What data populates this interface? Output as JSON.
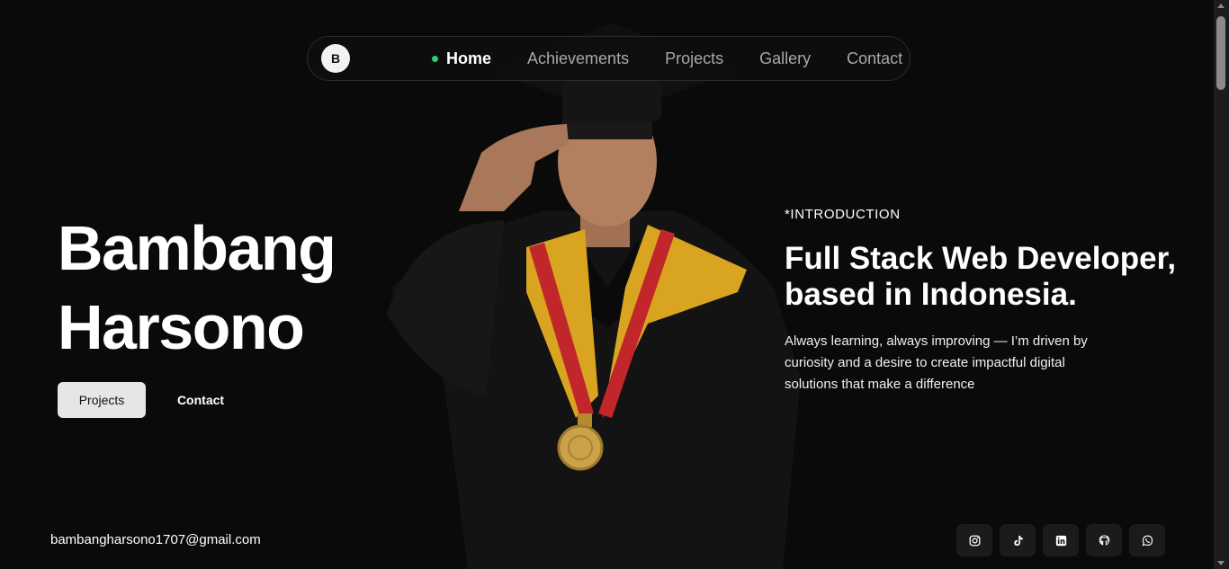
{
  "nav": {
    "logo": "B",
    "items": [
      {
        "label": "Home",
        "active": true
      },
      {
        "label": "Achievements",
        "active": false
      },
      {
        "label": "Projects",
        "active": false
      },
      {
        "label": "Gallery",
        "active": false
      },
      {
        "label": "Contact",
        "active": false
      }
    ],
    "active_color": "#22d17a"
  },
  "hero": {
    "first_name": "Bambang",
    "last_name": "Harsono",
    "primary_button": "Projects",
    "secondary_button": "Contact"
  },
  "intro": {
    "eyebrow": "*INTRODUCTION",
    "title": "Full Stack Web Developer, based in Indonesia.",
    "text": "Always learning, always improving — I’m driven by curiosity and a desire to create impactful digital solutions that make a difference"
  },
  "footer": {
    "email": "bambangharsono1707@gmail.com",
    "socials": [
      "instagram-icon",
      "tiktok-icon",
      "linkedin-icon",
      "github-icon",
      "whatsapp-icon"
    ]
  },
  "colors": {
    "background": "#0b0a0b",
    "sash_yellow": "#d9a521",
    "sash_red": "#c1262a",
    "medal": "#c9a24a"
  }
}
